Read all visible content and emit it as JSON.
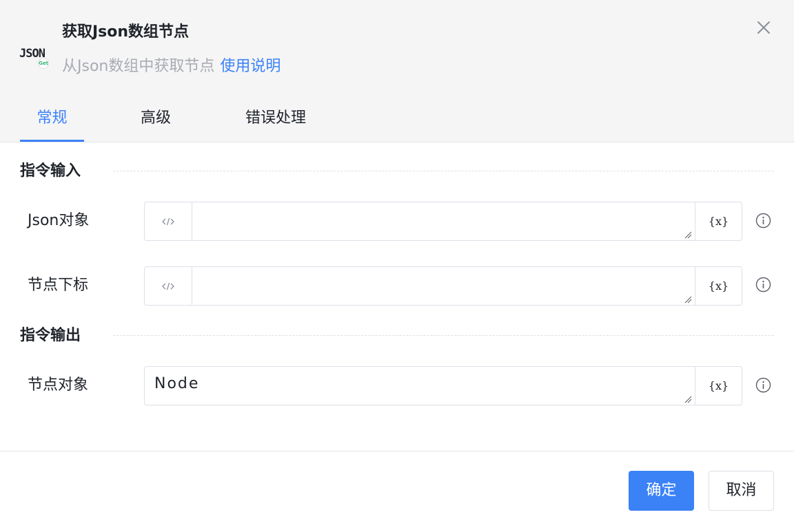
{
  "dialog": {
    "logo_text": "JSON",
    "logo_badge": "Get",
    "title": "获取Json数组节点",
    "subtitle": "从Json数组中获取节点",
    "help_link": "使用说明",
    "close_icon": "close-icon"
  },
  "tabs": [
    {
      "label": "常规",
      "active": true
    },
    {
      "label": "高级",
      "active": false
    },
    {
      "label": "错误处理",
      "active": false
    }
  ],
  "sections": {
    "input_title": "指令输入",
    "output_title": "指令输出"
  },
  "fields": {
    "json_object": {
      "label": "Json对象",
      "value": ""
    },
    "node_index": {
      "label": "节点下标",
      "value": ""
    },
    "node_object": {
      "label": "节点对象",
      "value": "Node"
    }
  },
  "icons": {
    "code": "code-icon",
    "variable": "variable-icon",
    "variable_glyph": "{x}",
    "info": "info-icon"
  },
  "footer": {
    "confirm_label": "确定",
    "cancel_label": "取消"
  },
  "colors": {
    "accent": "#3b82f6",
    "header_bg": "#f5f5f6",
    "border": "#dcdfe6"
  }
}
